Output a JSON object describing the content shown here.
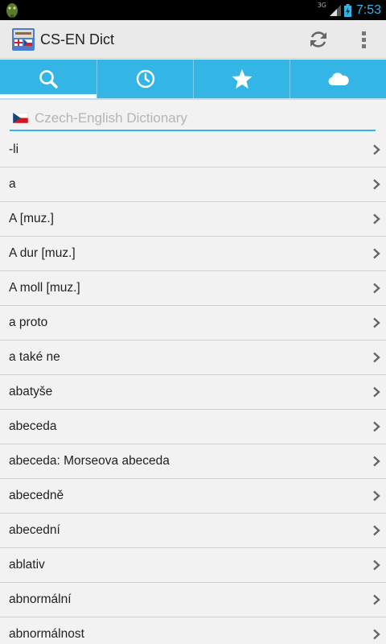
{
  "status_bar": {
    "network": "3G",
    "time": "7:53"
  },
  "app": {
    "title": "CS-EN Dict",
    "icon": "cs-en-dict-app-icon"
  },
  "tabs": [
    {
      "name": "search",
      "icon": "search-icon",
      "active": true
    },
    {
      "name": "history",
      "icon": "clock-icon",
      "active": false
    },
    {
      "name": "favorites",
      "icon": "star-icon",
      "active": false
    },
    {
      "name": "cloud",
      "icon": "cloud-icon",
      "active": false
    }
  ],
  "search": {
    "placeholder": "Czech-English Dictionary",
    "value": "",
    "flag": "czech-flag-icon"
  },
  "words": [
    "-li",
    "a",
    "A [muz.]",
    "A dur [muz.]",
    "A moll [muz.]",
    "a proto",
    "a také ne",
    "abatyše",
    "abeceda",
    "abeceda: Morseova abeceda",
    "abecedně",
    "abecední",
    "ablativ",
    "abnormální",
    "abnormálnost"
  ],
  "colors": {
    "accent": "#33b5e5",
    "actionbar": "#eaeaea",
    "background": "#f2f2f2"
  }
}
